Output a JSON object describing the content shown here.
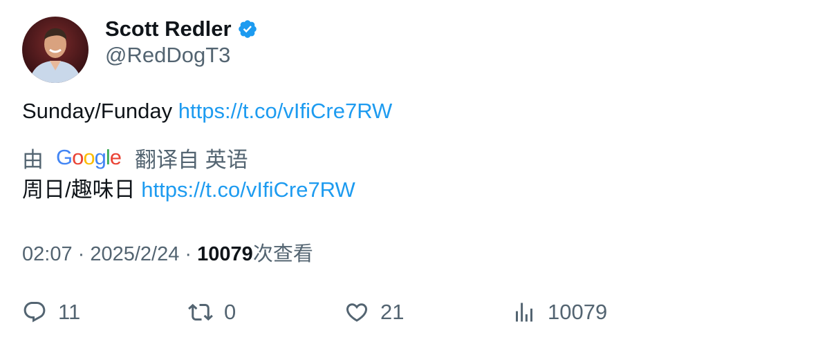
{
  "author": {
    "display_name": "Scott Redler",
    "handle": "@RedDogT3",
    "avatar_icon": "profile-photo",
    "verified_color": "#1d9bf0"
  },
  "tweet": {
    "text": "Sunday/Funday",
    "link": "https://t.co/vIfiCre7RW"
  },
  "translation": {
    "prefix": "由",
    "provider": "Google",
    "suffix": "翻译自 英语",
    "text": "周日/趣味日",
    "link": "https://t.co/vIfiCre7RW"
  },
  "meta": {
    "time": "02:07",
    "sep1": " · ",
    "date": "2025/2/24",
    "sep2": " · ",
    "views": "10079",
    "views_label": "次查看"
  },
  "actions": {
    "replies": "11",
    "retweets": "0",
    "likes": "21",
    "views": "10079"
  },
  "colors": {
    "link": "#1d9bf0",
    "secondary_text": "#536471",
    "primary_text": "#0f1419"
  }
}
